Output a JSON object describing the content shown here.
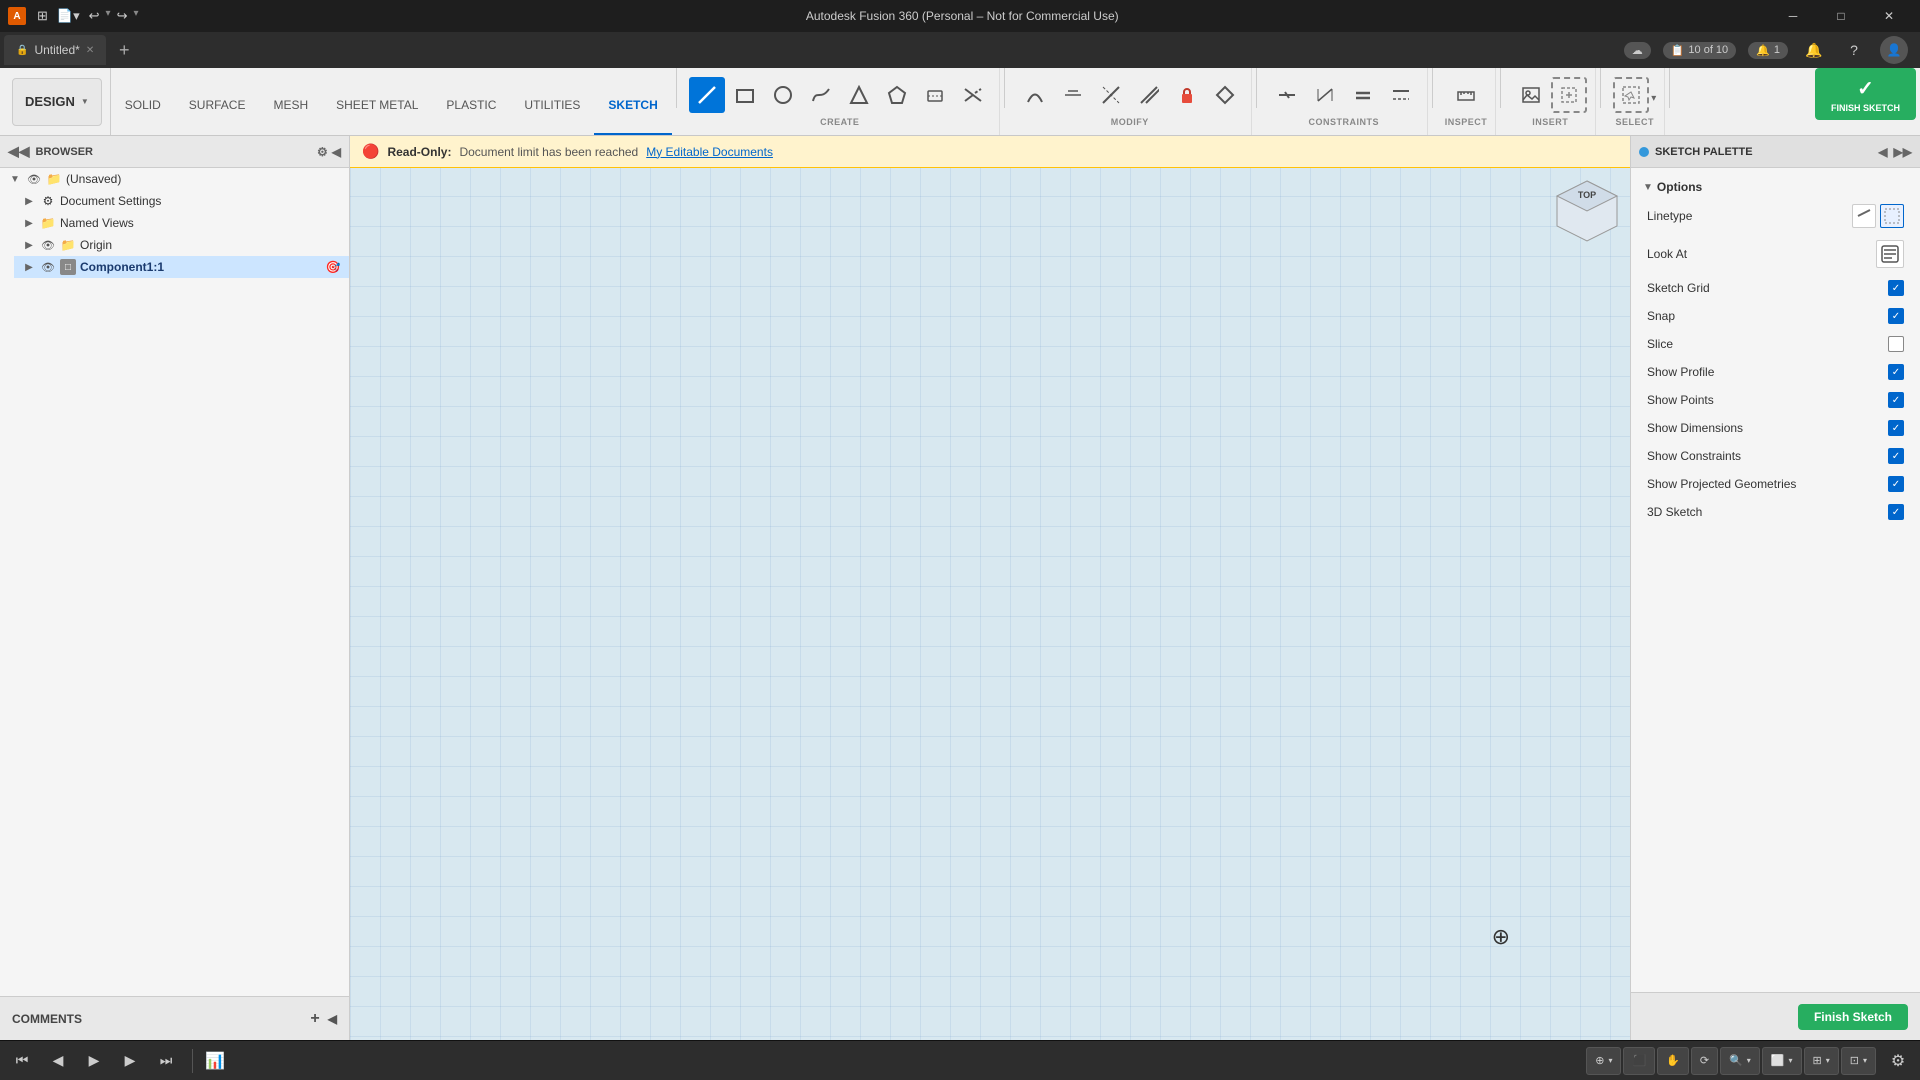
{
  "titlebar": {
    "app_name": "Autodesk Fusion 360 (Personal – Not for Commercial Use)",
    "app_icon": "A",
    "window_controls": [
      "minimize",
      "maximize",
      "close"
    ]
  },
  "tabbar": {
    "tab": {
      "lock_icon": "🔒",
      "title": "Untitled*",
      "close_icon": "×"
    },
    "new_tab_icon": "+",
    "counter": "10 of 10",
    "notification_icon": "🔔",
    "help_icon": "?",
    "cloud_icon": "☁"
  },
  "toolbar": {
    "design_label": "DESIGN",
    "tabs": [
      {
        "id": "solid",
        "label": "SOLID"
      },
      {
        "id": "surface",
        "label": "SURFACE"
      },
      {
        "id": "mesh",
        "label": "MESH"
      },
      {
        "id": "sheet_metal",
        "label": "SHEET METAL"
      },
      {
        "id": "plastic",
        "label": "PLASTIC"
      },
      {
        "id": "utilities",
        "label": "UTILITIES"
      },
      {
        "id": "sketch",
        "label": "SKETCH",
        "active": true
      }
    ],
    "sections": {
      "create": {
        "label": "CREATE"
      },
      "modify": {
        "label": "MODIFY"
      },
      "constraints": {
        "label": "CONSTRAINTS"
      },
      "inspect": {
        "label": "INSPECT"
      },
      "insert": {
        "label": "INSERT"
      },
      "select": {
        "label": "SELECT"
      },
      "finish_sketch": {
        "label": "FINISH SKETCH"
      }
    },
    "finish_sketch_btn": "FINISH SKETCH"
  },
  "readonly_bar": {
    "icon": "🔴",
    "label": "Read-Only:",
    "message": "Document limit has been reached",
    "link": "My Editable Documents"
  },
  "browser": {
    "title": "BROWSER",
    "tree": [
      {
        "id": "unsaved",
        "label": "(Unsaved)",
        "indent": 0,
        "expanded": true,
        "has_eye": true,
        "has_folder": true
      },
      {
        "id": "doc_settings",
        "label": "Document Settings",
        "indent": 1,
        "expanded": false,
        "has_gear": true
      },
      {
        "id": "named_views",
        "label": "Named Views",
        "indent": 1,
        "expanded": false,
        "has_folder": true
      },
      {
        "id": "origin",
        "label": "Origin",
        "indent": 1,
        "expanded": false,
        "has_eye": true,
        "has_folder": true
      },
      {
        "id": "component",
        "label": "Component1:1",
        "indent": 1,
        "expanded": false,
        "has_eye": true,
        "selected": true
      }
    ]
  },
  "comments": {
    "label": "COMMENTS"
  },
  "canvas": {
    "read_only_message": "Document limit has been reached",
    "view_label": "TOP"
  },
  "palette": {
    "title": "SKETCH PALETTE",
    "sections": [
      {
        "id": "options",
        "label": "Options",
        "expanded": true,
        "rows": [
          {
            "id": "linetype",
            "label": "Linetype",
            "type": "linetype_control"
          },
          {
            "id": "look_at",
            "label": "Look At",
            "type": "look_at_btn"
          },
          {
            "id": "sketch_grid",
            "label": "Sketch Grid",
            "type": "checkbox",
            "checked": true
          },
          {
            "id": "snap",
            "label": "Snap",
            "type": "checkbox",
            "checked": true
          },
          {
            "id": "slice",
            "label": "Slice",
            "type": "checkbox",
            "checked": false
          },
          {
            "id": "show_profile",
            "label": "Show Profile",
            "type": "checkbox",
            "checked": true
          },
          {
            "id": "show_points",
            "label": "Show Points",
            "type": "checkbox",
            "checked": true
          },
          {
            "id": "show_dimensions",
            "label": "Show Dimensions",
            "type": "checkbox",
            "checked": true
          },
          {
            "id": "show_constraints",
            "label": "Show Constraints",
            "type": "checkbox",
            "checked": true
          },
          {
            "id": "show_projected",
            "label": "Show Projected Geometries",
            "type": "checkbox",
            "checked": true
          },
          {
            "id": "sketch_3d",
            "label": "3D Sketch",
            "type": "checkbox",
            "checked": true
          }
        ]
      }
    ],
    "finish_sketch_btn": "Finish Sketch"
  },
  "bottom_toolbar": {
    "nav_buttons": [
      "first",
      "prev",
      "play",
      "next",
      "last"
    ],
    "tools": [
      {
        "id": "snap_tool",
        "icon": "⊕",
        "has_arrow": true
      },
      {
        "id": "capture",
        "icon": "⬛",
        "has_arrow": false
      },
      {
        "id": "pan",
        "icon": "✋",
        "has_arrow": false
      },
      {
        "id": "orbit",
        "icon": "⟳",
        "has_arrow": false
      },
      {
        "id": "zoom",
        "icon": "🔍",
        "has_arrow": true
      },
      {
        "id": "display",
        "icon": "⬜",
        "has_arrow": true
      },
      {
        "id": "grid",
        "icon": "⊞",
        "has_arrow": true
      },
      {
        "id": "viewport",
        "icon": "⊡",
        "has_arrow": true
      }
    ],
    "settings_icon": "⚙"
  }
}
